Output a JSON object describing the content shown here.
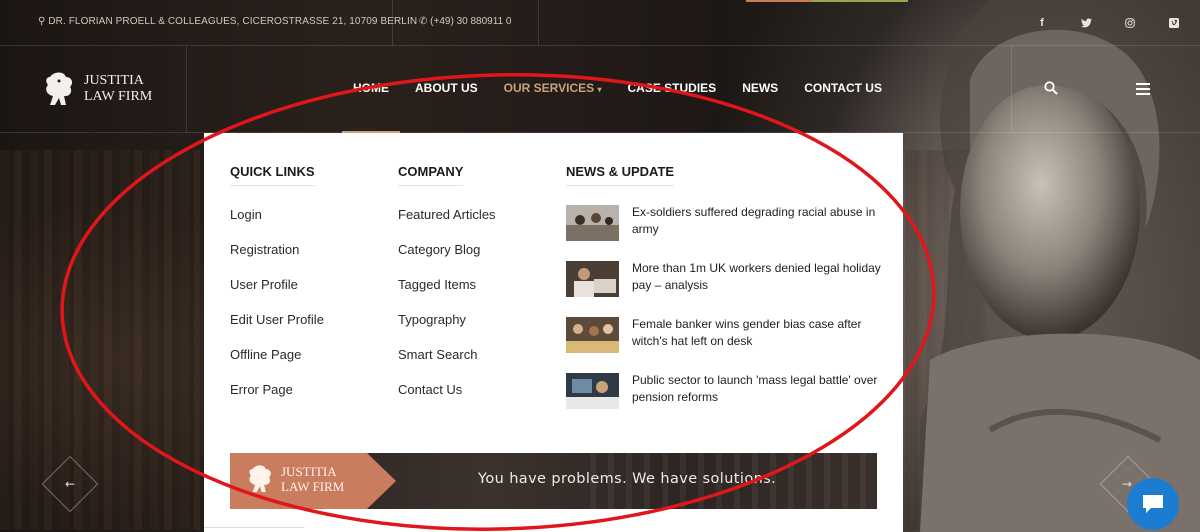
{
  "topbar": {
    "address": "DR. FLORIAN PROELL & COLLEAGUES, CICEROSTRASSE 21, 10709 BERLIN",
    "phone": "(+49) 30 880911 0",
    "socials": [
      "f",
      "t",
      "ig",
      "v"
    ]
  },
  "logo": {
    "line1": "JUSTITIA",
    "line2": "LAW FIRM"
  },
  "nav": {
    "items": [
      {
        "label": "HOME"
      },
      {
        "label": "ABOUT US"
      },
      {
        "label": "OUR SERVICES"
      },
      {
        "label": "CASE STUDIES"
      },
      {
        "label": "NEWS"
      },
      {
        "label": "CONTACT US"
      }
    ],
    "active": "OUR SERVICES",
    "caret": "▾"
  },
  "mega_menu": {
    "quick_links": {
      "heading": "QUICK LINKS",
      "items": [
        "Login",
        "Registration",
        "User Profile",
        "Edit User Profile",
        "Offline Page",
        "Error Page"
      ]
    },
    "company": {
      "heading": "COMPANY",
      "items": [
        "Featured Articles",
        "Category Blog",
        "Tagged Items",
        "Typography",
        "Smart Search",
        "Contact Us"
      ]
    },
    "news": {
      "heading": "NEWS & UPDATE",
      "items": [
        {
          "title": "Ex-soldiers suffered degrading racial abuse in army"
        },
        {
          "title": "More than 1m UK workers denied legal holiday pay – analysis"
        },
        {
          "title": "Female banker wins gender bias case after witch's hat left on desk"
        },
        {
          "title": "Public sector to launch 'mass legal battle' over pension reforms"
        }
      ]
    },
    "promo": {
      "logo_line1": "JUSTITIA",
      "logo_line2": "LAW FIRM",
      "tagline": "You have problems. We have solutions."
    }
  },
  "slider": {
    "prev": "←",
    "next": "→"
  },
  "colors": {
    "accent": "#c9a27a",
    "promo_orange": "#c97d5e",
    "chat_blue": "#1c7dd0",
    "annotation_red": "#e0161b"
  }
}
